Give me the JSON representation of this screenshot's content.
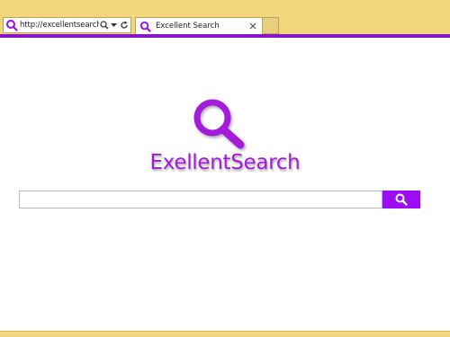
{
  "browser": {
    "address_url": "http://excellentsearch...",
    "active_tab_title": "Excellent Search",
    "accent_color": "#8a14c9",
    "chrome_color": "#f2d67e",
    "icons": [
      "site-favicon-icon",
      "search-icon",
      "dropdown-arrow-icon",
      "refresh-icon",
      "close-icon"
    ]
  },
  "page": {
    "logo_text": "ExellentSearch",
    "logo_color": "#a31ad8",
    "search": {
      "value": "",
      "placeholder": "",
      "button_color": "#9c0df5",
      "button_icon": "search-icon"
    }
  }
}
